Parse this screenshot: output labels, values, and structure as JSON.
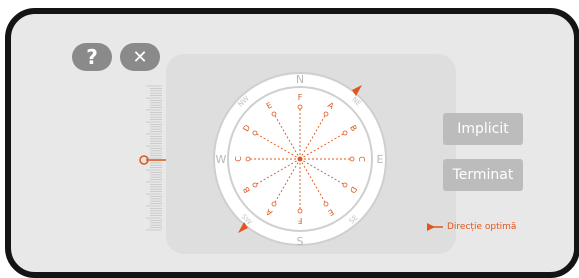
{
  "toolbar": {
    "help_label": "?",
    "close_label": "✕"
  },
  "compass": {
    "north": "N",
    "south": "S",
    "east": "E",
    "west": "W",
    "ne": "NE",
    "nw": "NW",
    "se": "SE",
    "sw": "SW",
    "line_letters": [
      "F",
      "A",
      "B",
      "C",
      "D",
      "E",
      "F",
      "A",
      "B",
      "C",
      "D",
      "E"
    ]
  },
  "buttons": {
    "default_label": "Implicit",
    "done_label": "Terminat"
  },
  "legend": {
    "label": "Direcție optimă"
  },
  "colors": {
    "accent": "#e0561b",
    "ring": "#cfcfcf",
    "button": "#bcbcbc"
  }
}
